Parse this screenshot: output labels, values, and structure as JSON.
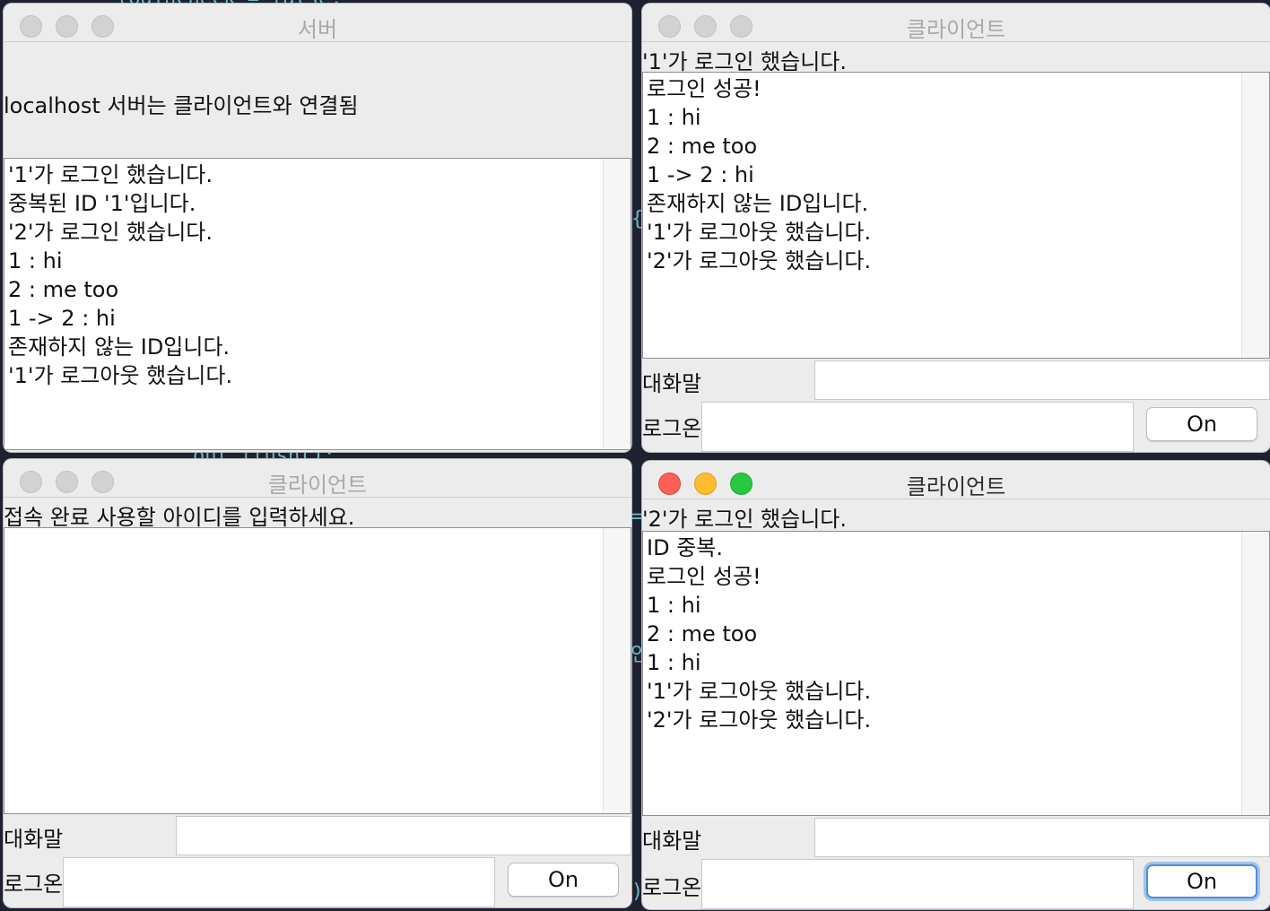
{
  "background": {
    "code_fragments": [
      "loginCheck = false;",
      "{",
      "out.flush();",
      "=",
      "인",
      ")"
    ]
  },
  "server_window": {
    "title": "서버",
    "status": "localhost 서버는 클라이언트와 연결됨",
    "log": [
      "'1'가 로그인 했습니다.",
      "중복된 ID '1'입니다.",
      "'2'가 로그인 했습니다.",
      "1 : hi",
      "2 : me too",
      "1 -> 2 : hi",
      "존재하지 않는 ID입니다.",
      "'1'가 로그아웃 했습니다."
    ]
  },
  "client_top_right": {
    "title": "클라이언트",
    "status": "'1'가 로그인 했습니다.",
    "log": [
      "로그인 성공!",
      "1 : hi",
      "2 : me too",
      "1 -> 2 : hi",
      "존재하지 않는 ID입니다.",
      "'1'가 로그아웃 했습니다.",
      "'2'가 로그아웃 했습니다."
    ],
    "chat_label": "대화말",
    "chat_value": "",
    "logon_label": "로그온",
    "logon_value": "",
    "on_button": "On"
  },
  "client_bottom_left": {
    "title": "클라이언트",
    "status": "접속 완료 사용할 아이디를 입력하세요.",
    "log": [],
    "chat_label": "대화말",
    "chat_value": "",
    "logon_label": "로그온",
    "logon_value": "",
    "on_button": "On"
  },
  "client_bottom_right": {
    "title": "클라이언트",
    "status": "'2'가 로그인 했습니다.",
    "log": [
      "ID 중복.",
      "로그인 성공!",
      "1 : hi",
      "2 : me too",
      "1 : hi",
      "'1'가 로그아웃 했습니다.",
      "'2'가 로그아웃 했습니다."
    ],
    "chat_label": "대화말",
    "chat_value": "",
    "logon_label": "로그온",
    "logon_value": "",
    "on_button": "On"
  }
}
